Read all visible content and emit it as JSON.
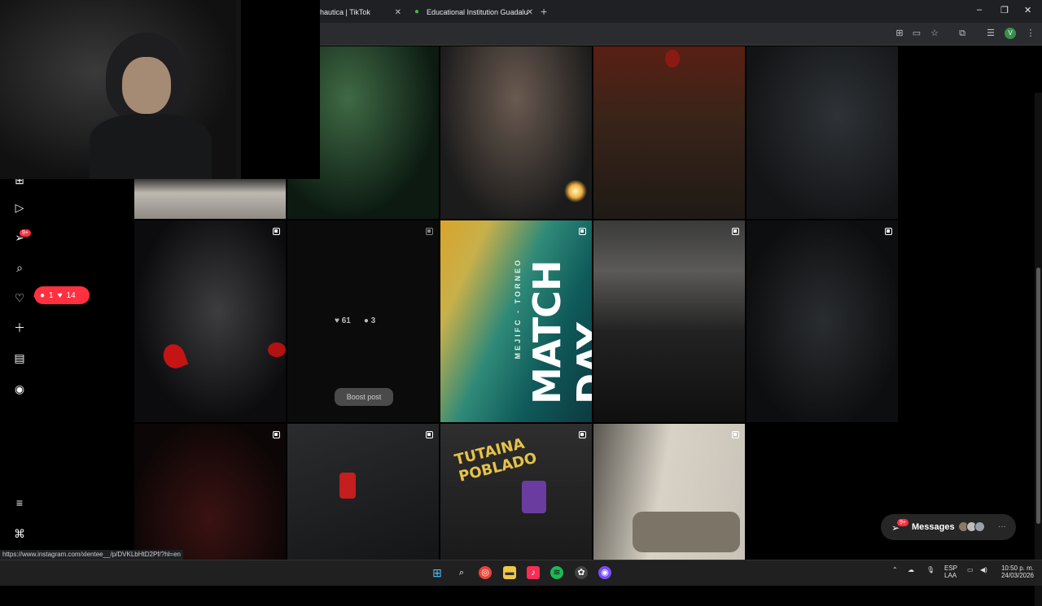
{
  "browser": {
    "tabs": [
      {
        "label": "hautica | TikTok"
      },
      {
        "label": "Educational Institution Guadalu"
      }
    ],
    "new_tab": "+",
    "window_controls": {
      "minimize": "–",
      "restore": "❐",
      "close": "✕"
    },
    "status_url": "https://www.instagram.com/xlentee__/p/DVKLbHtD2Pf/?hl=en"
  },
  "sidebar": {
    "notifications_badge": "9+",
    "notification_pill": {
      "comments": "1",
      "likes": "14"
    }
  },
  "posts": [
    {
      "row": 1,
      "col": 1,
      "desc": "light partial",
      "multi": false
    },
    {
      "row": 1,
      "col": 2,
      "desc": "club green",
      "multi": false
    },
    {
      "row": 1,
      "col": 3,
      "desc": "woman sparkler",
      "multi": false
    },
    {
      "row": 1,
      "col": 4,
      "desc": "balloons red",
      "multi": false
    },
    {
      "row": 1,
      "col": 5,
      "desc": "studio dj",
      "multi": false
    },
    {
      "row": 2,
      "col": 1,
      "desc": "devil horns party",
      "multi": true
    },
    {
      "row": 2,
      "col": 2,
      "desc": "dark",
      "multi": true,
      "hover": {
        "likes": "61",
        "comments": "3",
        "boost": "Boost post"
      }
    },
    {
      "row": 2,
      "col": 3,
      "desc": "match day poster",
      "multi": true,
      "poster": {
        "small": "MEJIFC - TORNEO",
        "big": "MATCH DAY"
      }
    },
    {
      "row": 2,
      "col": 4,
      "desc": "two men",
      "multi": true
    },
    {
      "row": 2,
      "col": 5,
      "desc": "group wheelchair",
      "multi": true
    },
    {
      "row": 3,
      "col": 1,
      "desc": "stage red",
      "multi": true
    },
    {
      "row": 3,
      "col": 2,
      "desc": "red corset",
      "multi": true
    },
    {
      "row": 3,
      "col": 3,
      "desc": "tutaina poblado",
      "multi": true,
      "sign": "TUTAINA POBLADO"
    },
    {
      "row": 3,
      "col": 4,
      "desc": "sofa",
      "multi": true
    }
  ],
  "messages": {
    "label": "Messages",
    "badge": "9+"
  },
  "taskbar": {
    "lang": "ESP",
    "lang2": "LAA",
    "time": "10:50 p. m.",
    "date": "24/03/2026"
  }
}
